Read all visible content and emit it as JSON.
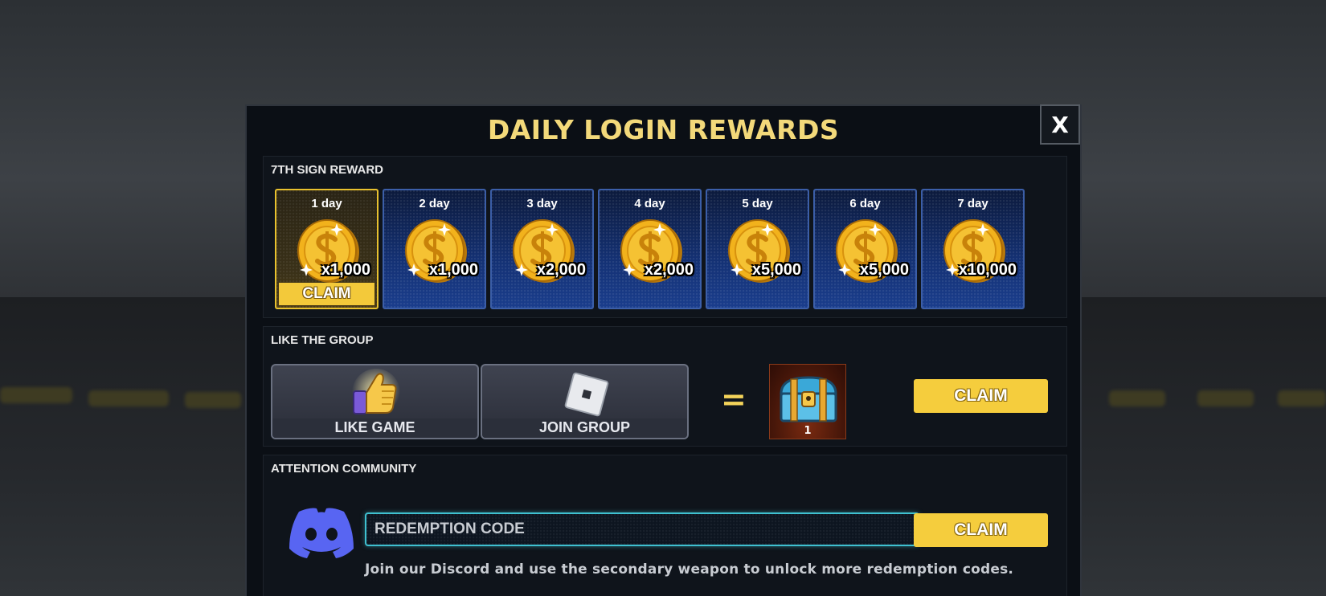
{
  "title": "DAILY LOGIN REWARDS",
  "close_label": "X",
  "sign_reward": {
    "label": "7TH SIGN REWARD",
    "days": [
      {
        "label": "1 day",
        "amount": "x1,000",
        "active": true,
        "claim": "CLAIM"
      },
      {
        "label": "2 day",
        "amount": "x1,000",
        "active": false
      },
      {
        "label": "3 day",
        "amount": "x2,000",
        "active": false
      },
      {
        "label": "4 day",
        "amount": "x2,000",
        "active": false
      },
      {
        "label": "5 day",
        "amount": "x5,000",
        "active": false
      },
      {
        "label": "6 day",
        "amount": "x5,000",
        "active": false
      },
      {
        "label": "7 day",
        "amount": "x10,000",
        "active": false
      }
    ]
  },
  "group": {
    "label": "LIKE THE GROUP",
    "like_label": "LIKE  GAME",
    "join_label": "JOIN GROUP",
    "equals": "=",
    "reward_count": "1",
    "claim": "CLAIM"
  },
  "community": {
    "label": "ATTENTION COMMUNITY",
    "code_placeholder": "REDEMPTION CODE",
    "claim": "CLAIM",
    "hint": "Join our Discord and use the secondary weapon to unlock more redemption codes."
  },
  "colors": {
    "title": "#f3d97a",
    "claim_button": "#f5cd3d",
    "day_card": "#143174",
    "discord": "#5865f2",
    "input_border": "#3fc0d0"
  },
  "icons": [
    "coin-icon",
    "thumbs-up-icon",
    "roblox-logo-icon",
    "chest-icon",
    "discord-icon",
    "close-icon"
  ]
}
